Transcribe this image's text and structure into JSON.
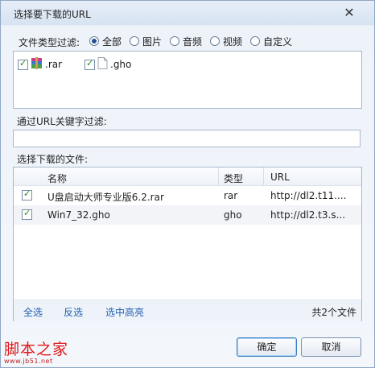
{
  "dialog": {
    "title": "选择要下载的URL"
  },
  "type_filter": {
    "label": "文件类型过滤:",
    "options": [
      {
        "label": "全部",
        "selected": true
      },
      {
        "label": "图片",
        "selected": false
      },
      {
        "label": "音频",
        "selected": false
      },
      {
        "label": "视频",
        "selected": false
      },
      {
        "label": "自定义",
        "selected": false
      }
    ],
    "extensions": [
      {
        "label": ".rar",
        "checked": true,
        "icon": "winrar-archive-icon"
      },
      {
        "label": ".gho",
        "checked": true,
        "icon": "blank-file-icon"
      }
    ]
  },
  "keyword_filter": {
    "label": "通过URL关键字过滤:",
    "value": ""
  },
  "files": {
    "label": "选择下载的文件:",
    "columns": [
      "名称",
      "类型",
      "URL"
    ],
    "rows": [
      {
        "checked": true,
        "name": "U盘启动大师专业版6.2.rar",
        "type": "rar",
        "url": "http://dl2.t11...."
      },
      {
        "checked": true,
        "name": "Win7_32.gho",
        "type": "gho",
        "url": "http://dl2.t3.s..."
      }
    ],
    "footer": {
      "select_all": "全选",
      "invert": "反选",
      "highlight": "选中高亮",
      "count": "共2个文件"
    }
  },
  "buttons": {
    "ok": "确定",
    "cancel": "取消"
  },
  "watermark": {
    "text": "脚本之家",
    "url": "www.jb51.net"
  },
  "colors": {
    "accent": "#2360b1",
    "check": "#1c8d1c",
    "watermark": "#e01818"
  }
}
